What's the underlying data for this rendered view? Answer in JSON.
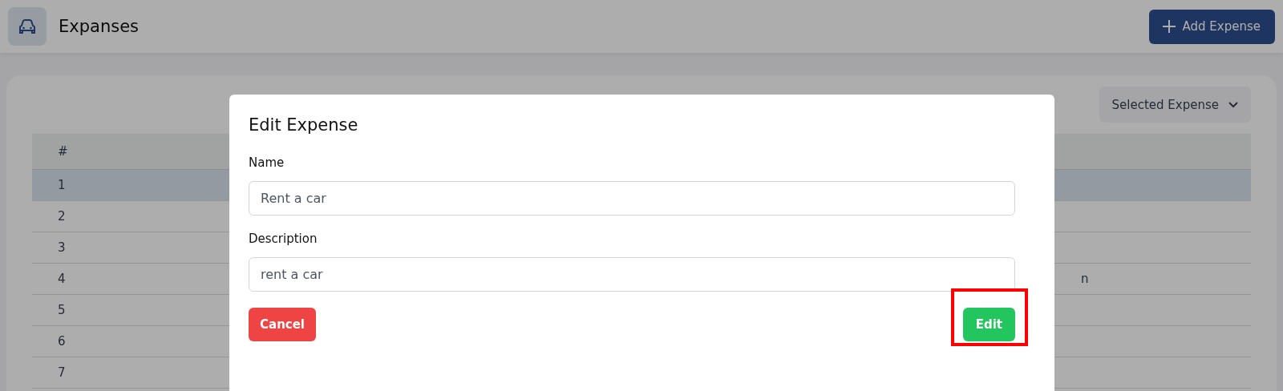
{
  "header": {
    "title": "Expanses",
    "add_button": "Add Expense"
  },
  "filter": {
    "label": "Selected Expense"
  },
  "table": {
    "columns": [
      "#"
    ],
    "rows": [
      {
        "number": "1",
        "selected": true
      },
      {
        "number": "2",
        "selected": false
      },
      {
        "number": "3",
        "selected": false
      },
      {
        "number": "4",
        "selected": false,
        "column_3": "n"
      },
      {
        "number": "5",
        "selected": false
      },
      {
        "number": "6",
        "selected": false
      },
      {
        "number": "7",
        "selected": false
      }
    ]
  },
  "dialog": {
    "title": "Edit Expense",
    "fields": [
      {
        "label": "Name",
        "value": "Rent a car"
      },
      {
        "label": "Description",
        "value": "rent a car"
      }
    ],
    "cancel_button": "Cancel",
    "confirm_button": "Edit",
    "confirm_highlighted": true
  }
}
